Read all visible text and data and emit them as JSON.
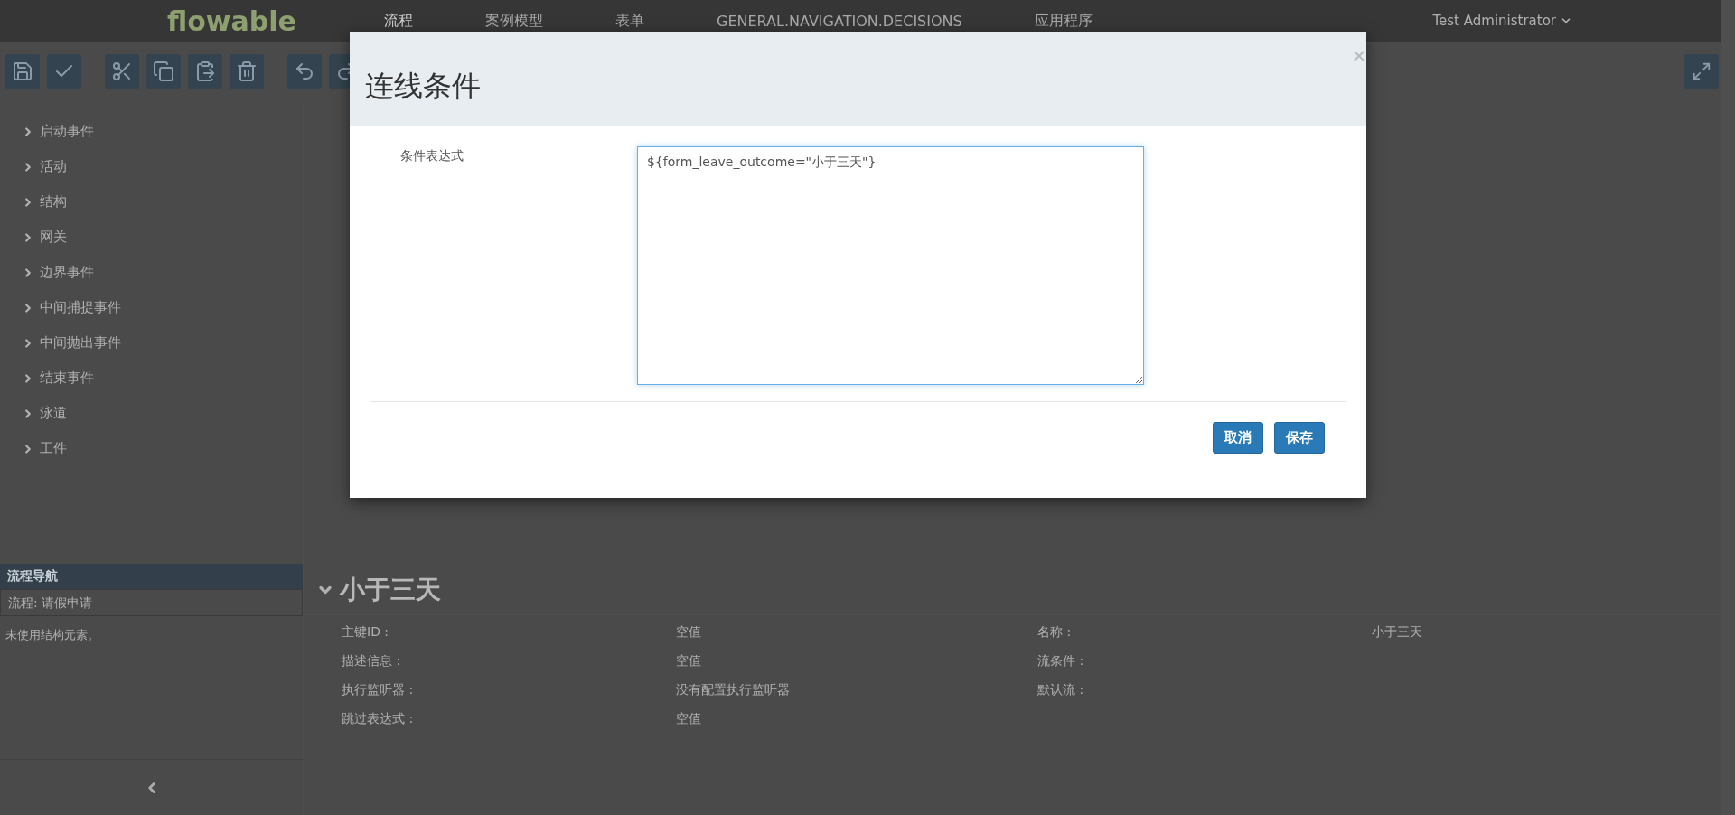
{
  "nav": {
    "logo": "flowable",
    "items": [
      {
        "label": "流程",
        "selected": true
      },
      {
        "label": "案例模型",
        "selected": false
      },
      {
        "label": "表单",
        "selected": false
      },
      {
        "label": "GENERAL.NAVIGATION.DECISIONS",
        "selected": false
      },
      {
        "label": "应用程序",
        "selected": false
      }
    ],
    "user": "Test Administrator"
  },
  "palette": {
    "groups": [
      {
        "label": "启动事件",
        "expanded": false
      },
      {
        "label": "活动",
        "expanded": false
      },
      {
        "label": "结构",
        "expanded": false
      },
      {
        "label": "网关",
        "expanded": false
      },
      {
        "label": "边界事件",
        "expanded": false
      },
      {
        "label": "中间捕捉事件",
        "expanded": false
      },
      {
        "label": "中间抛出事件",
        "expanded": false
      },
      {
        "label": "结束事件",
        "expanded": false
      },
      {
        "label": "泳道",
        "expanded": false
      },
      {
        "label": "工件",
        "expanded": false
      }
    ]
  },
  "navigator": {
    "title": "流程导航",
    "process": "流程: 请假申请",
    "note": "未使用结构元素。"
  },
  "properties": {
    "title": "小于三天",
    "expanded": true,
    "rows": [
      [
        {
          "label": "主键ID :",
          "value": "空值"
        },
        {
          "label": "名称 :",
          "value": "小于三天"
        }
      ],
      [
        {
          "label": "描述信息 :",
          "value": "空值"
        },
        {
          "label": "流条件 :"
        }
      ],
      [
        {
          "label": "执行监听器 :",
          "value": "没有配置执行监听器"
        },
        {
          "label": "默认流 :"
        }
      ],
      [
        {
          "label": "跳过表达式 :",
          "value": "空值"
        }
      ]
    ]
  },
  "dialog": {
    "title": "连线条件",
    "label": "条件表达式",
    "value": "${form_leave_outcome=\"小于三天\"}",
    "buttons": [
      {
        "label": "取消"
      },
      {
        "label": "保存"
      }
    ]
  }
}
